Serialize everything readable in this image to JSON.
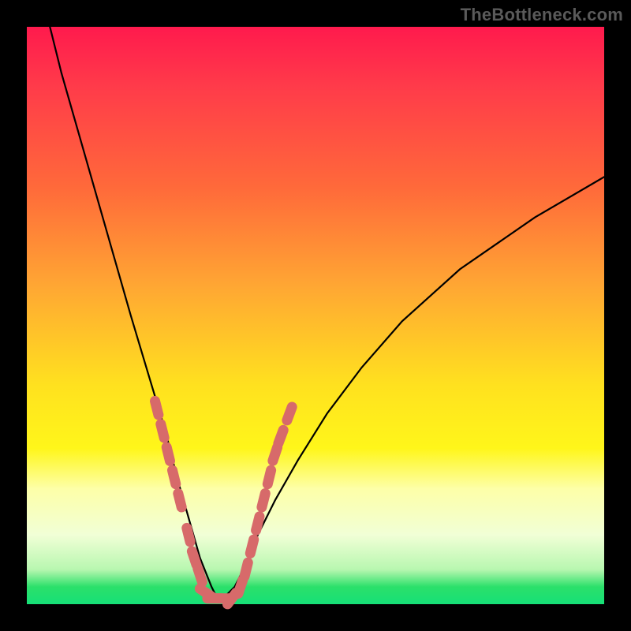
{
  "watermark": "TheBottleneck.com",
  "colors": {
    "frame": "#000000",
    "curve": "#000000",
    "points": "#d76a6a",
    "gradient_top": "#ff1a4d",
    "gradient_bottom": "#16e077"
  },
  "chart_data": {
    "type": "line",
    "title": "",
    "xlabel": "",
    "ylabel": "",
    "xlim": [
      0,
      100
    ],
    "ylim": [
      0,
      100
    ],
    "grid": false,
    "legend": false,
    "curve": {
      "description": "V-shaped bottleneck curve; steep descent from upper-left to a trough near x≈33, then rising with decreasing slope toward upper-right",
      "x": [
        4,
        6,
        10,
        14,
        18,
        21,
        24,
        26,
        28,
        30,
        32,
        33,
        34,
        36,
        38,
        40,
        43,
        47,
        52,
        58,
        65,
        75,
        88,
        100
      ],
      "y": [
        100,
        92,
        78,
        64,
        50,
        40,
        30,
        22,
        15,
        8,
        3,
        1,
        1,
        3,
        7,
        12,
        18,
        25,
        33,
        41,
        49,
        58,
        67,
        74
      ]
    },
    "markers": {
      "description": "Salmon pill/rounded markers clustered along the lower portion of both arms and across the trough",
      "points": [
        {
          "x": 22.5,
          "y": 34
        },
        {
          "x": 23.5,
          "y": 30
        },
        {
          "x": 24.5,
          "y": 26
        },
        {
          "x": 25.5,
          "y": 22
        },
        {
          "x": 26.5,
          "y": 18
        },
        {
          "x": 28.0,
          "y": 12
        },
        {
          "x": 29.0,
          "y": 8
        },
        {
          "x": 30.0,
          "y": 5
        },
        {
          "x": 31.0,
          "y": 2
        },
        {
          "x": 32.5,
          "y": 1
        },
        {
          "x": 34.0,
          "y": 1
        },
        {
          "x": 35.5,
          "y": 1
        },
        {
          "x": 37.0,
          "y": 3
        },
        {
          "x": 38.0,
          "y": 6
        },
        {
          "x": 39.0,
          "y": 10
        },
        {
          "x": 40.0,
          "y": 14
        },
        {
          "x": 41.0,
          "y": 18
        },
        {
          "x": 42.0,
          "y": 22
        },
        {
          "x": 43.0,
          "y": 26
        },
        {
          "x": 44.0,
          "y": 29
        },
        {
          "x": 45.5,
          "y": 33
        }
      ]
    }
  }
}
